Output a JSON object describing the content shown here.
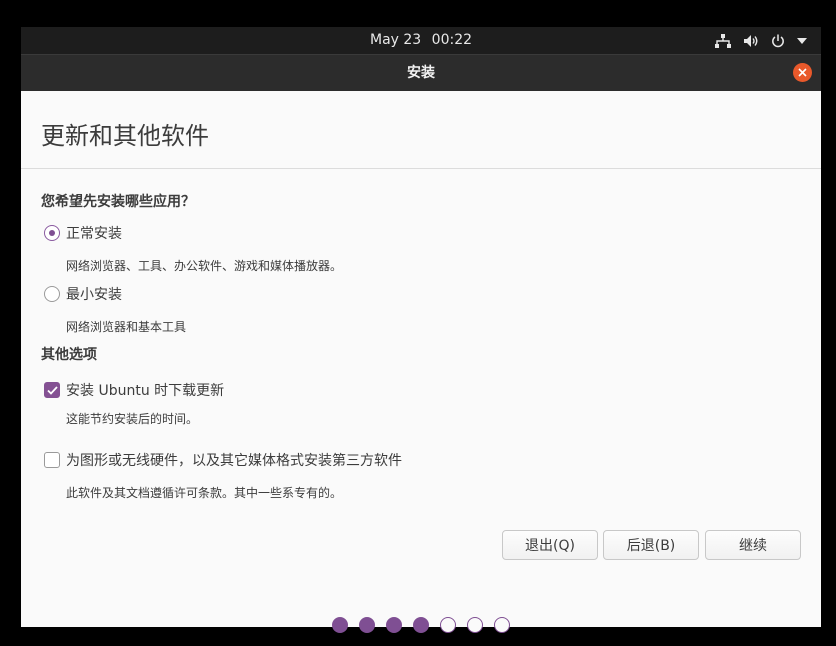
{
  "topbar": {
    "date": "May 23",
    "time": "00:22",
    "icons": [
      "network-icon",
      "volume-icon",
      "power-icon",
      "menu-arrow-icon"
    ]
  },
  "window": {
    "title": "安装",
    "close_icon": "close-icon"
  },
  "page": {
    "title": "更新和其他软件"
  },
  "apps_section": {
    "heading": "您希望先安装哪些应用？",
    "options": [
      {
        "label": "正常安装",
        "desc": "网络浏览器、工具、办公软件、游戏和媒体播放器。",
        "selected": true
      },
      {
        "label": "最小安装",
        "desc": "网络浏览器和基本工具",
        "selected": false
      }
    ]
  },
  "other_section": {
    "heading": "其他选项",
    "options": [
      {
        "label": "安装 Ubuntu 时下载更新",
        "desc": "这能节约安装后的时间。",
        "checked": true
      },
      {
        "label": "为图形或无线硬件，以及其它媒体格式安装第三方软件",
        "desc": "此软件及其文档遵循许可条款。其中一些系专有的。",
        "checked": false
      }
    ]
  },
  "buttons": {
    "quit": "退出(Q)",
    "back": "后退(B)",
    "continue": "继续"
  },
  "progress": {
    "total_steps": 7,
    "completed_steps": 4
  },
  "colors": {
    "accent": "#7f4f93",
    "close": "#e9592b",
    "topbar": "#1d1d1d",
    "titlebar": "#2c2c2c"
  }
}
